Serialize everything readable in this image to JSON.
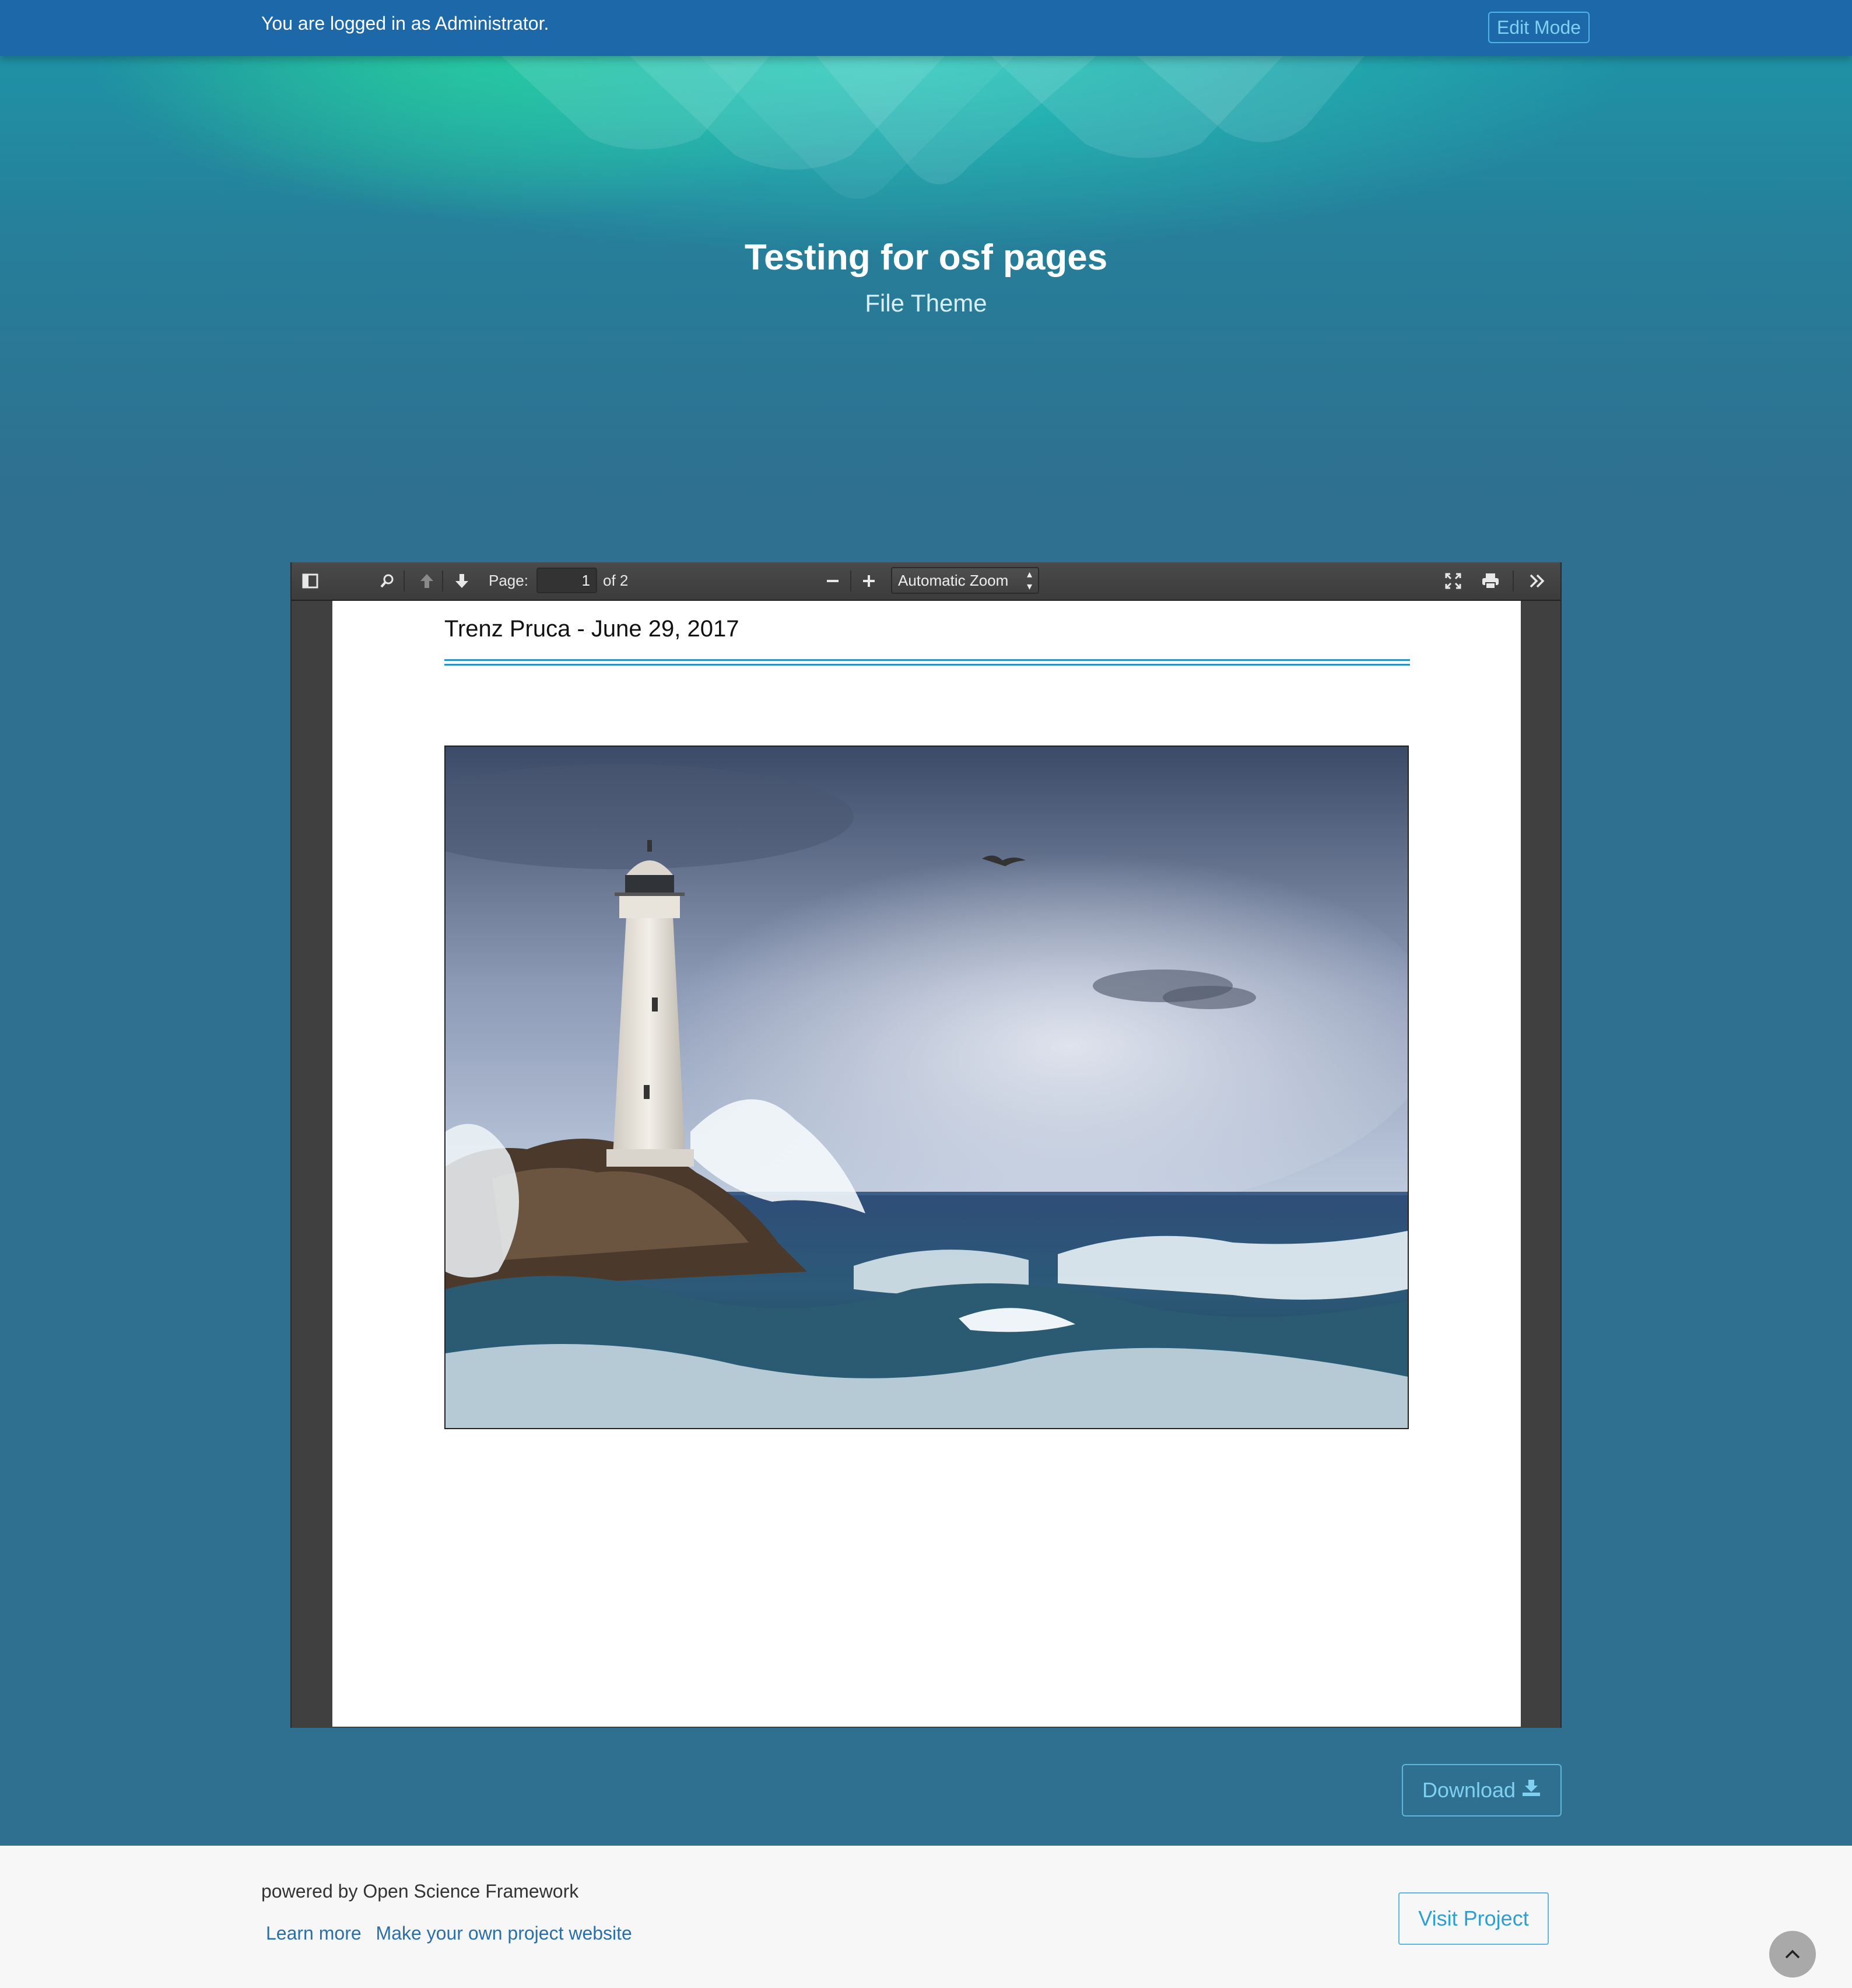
{
  "admin_bar": {
    "logged_in_text": "You are logged in as Administrator.",
    "edit_mode_label": "Edit Mode"
  },
  "hero": {
    "title": "Testing for osf pages",
    "subtitle": "File Theme"
  },
  "pdf_viewer": {
    "toolbar": {
      "page_label": "Page:",
      "current_page": "1",
      "page_count_text": "of 2",
      "zoom_value": "Automatic Zoom",
      "icons": [
        "sidebar-toggle-icon",
        "search-icon",
        "previous-page-icon",
        "next-page-icon",
        "zoom-out-icon",
        "zoom-in-icon",
        "fullscreen-icon",
        "print-icon",
        "more-tools-icon"
      ]
    },
    "document": {
      "heading": "Trenz Pruca - June 29, 2017",
      "rule_color": "#2a92c0"
    }
  },
  "actions": {
    "download_label": "Download"
  },
  "footer": {
    "powered_by": "powered by Open Science Framework",
    "learn_more": "Learn more",
    "make_website": "Make your own project website",
    "visit_project": "Visit Project"
  },
  "colors": {
    "admin_bar": "#1d68a8",
    "page_background": "#2f6f8f",
    "accent": "#5fb6d8",
    "footer": "#f7f7f7"
  }
}
